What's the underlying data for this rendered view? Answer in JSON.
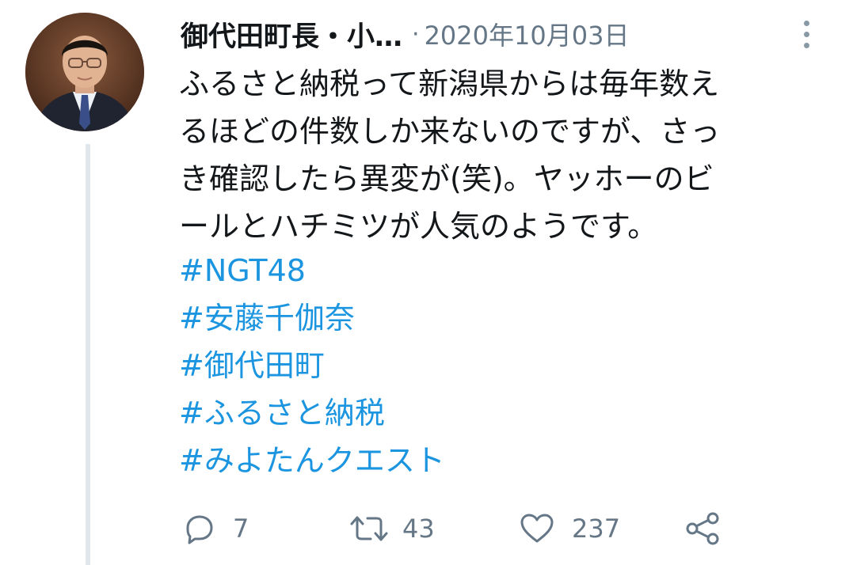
{
  "author": {
    "name": "御代田町長・小…",
    "separator": "·",
    "timestamp": "2020年10月03日"
  },
  "tweet": {
    "lines": [
      "ふるさと納税って新潟県からは毎年数え",
      "るほどの件数しか来ないのですが、さっ",
      "き確認したら異変が(笑)。ヤッホーのビ",
      "ールとハチミツが人気のようです。"
    ],
    "hashtags": [
      "#NGT48",
      "#安藤千伽奈",
      "#御代田町",
      "#ふるさと納税",
      "#みよたんクエスト"
    ]
  },
  "actions": {
    "reply_count": "7",
    "retweet_count": "43",
    "like_count": "237"
  },
  "icons": {
    "reply": "reply-icon",
    "retweet": "retweet-icon",
    "like": "heart-icon",
    "share": "share-icon",
    "more": "more-options-icon"
  },
  "colors": {
    "hashtag": "#1b95e0",
    "muted": "#657786",
    "text": "#14171a",
    "thread_line": "#e1e8ed"
  }
}
